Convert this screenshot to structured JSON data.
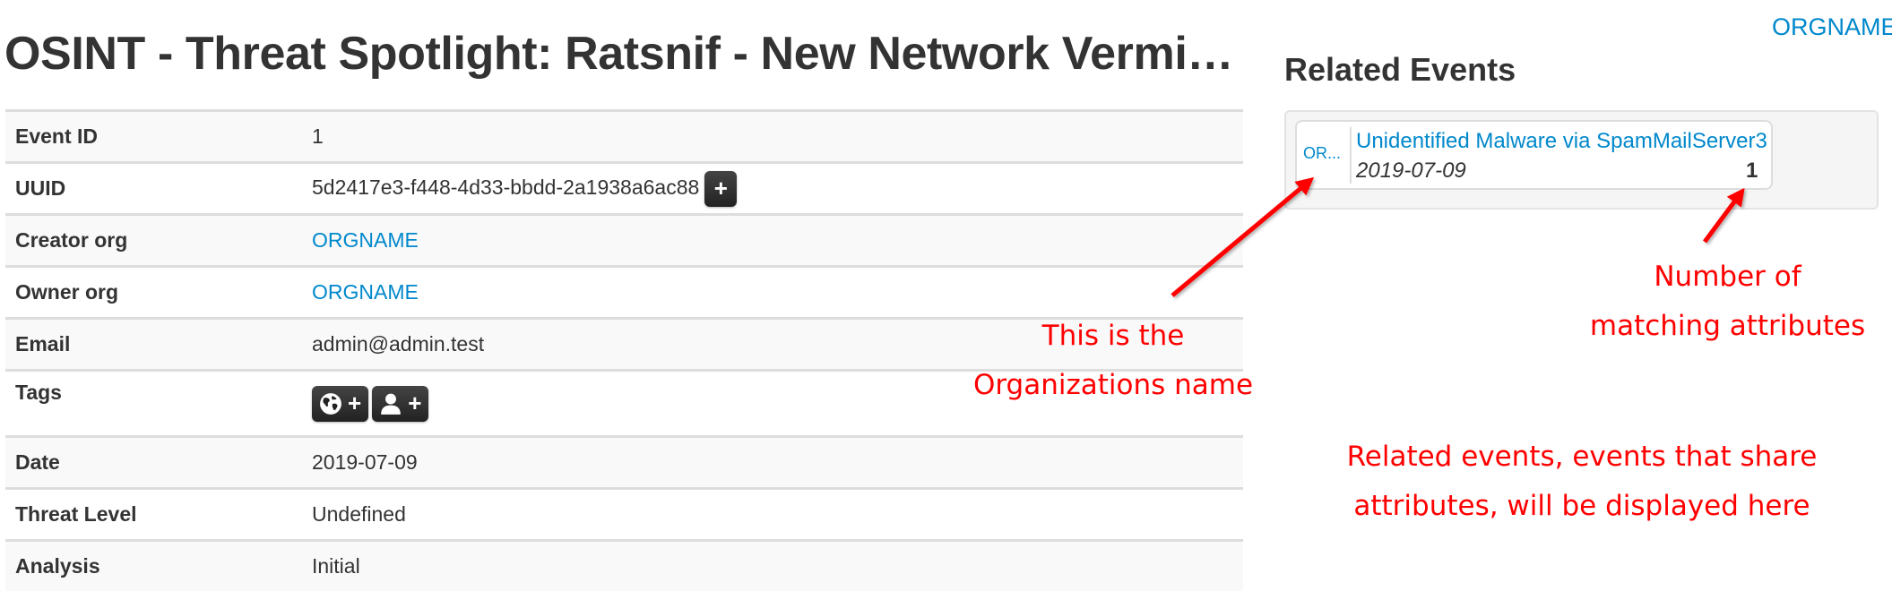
{
  "header": {
    "org_link": "ORGNAME",
    "page_title": "OSINT - Threat Spotlight: Ratsnif - New Network Vermin..."
  },
  "details": {
    "rows": [
      {
        "label": "Event ID",
        "value": "1"
      },
      {
        "label": "UUID",
        "value": "5d2417e3-f448-4d33-bbdd-2a1938a6ac88",
        "action": "+"
      },
      {
        "label": "Creator org",
        "value": "ORGNAME"
      },
      {
        "label": "Owner org",
        "value": "ORGNAME"
      },
      {
        "label": "Email",
        "value": "admin@admin.test"
      },
      {
        "label": "Tags",
        "buttons": [
          {
            "icon": "globe-icon",
            "label": "+"
          },
          {
            "icon": "user-icon",
            "label": "+"
          }
        ]
      },
      {
        "label": "Date",
        "value": "2019-07-09"
      },
      {
        "label": "Threat Level",
        "value": "Undefined"
      },
      {
        "label": "Analysis",
        "value": "Initial"
      }
    ]
  },
  "related_events": {
    "title": "Related Events",
    "items": [
      {
        "org": "OR...",
        "title": "Unidentified Malware via SpamMailServer3",
        "date": "2019-07-09",
        "count": "1"
      }
    ]
  },
  "annotations": {
    "org_note": [
      "This is the",
      "Organizations name"
    ],
    "count_note": [
      "Number of",
      "matching attributes"
    ],
    "related_note": [
      "Related events, events that share",
      "attributes, will be displayed here"
    ],
    "color": "#ff0000"
  },
  "colors": {
    "link": "#0088cc",
    "text": "#333333",
    "stripe": "#f9f9f9",
    "annotation": "#ff0000"
  }
}
